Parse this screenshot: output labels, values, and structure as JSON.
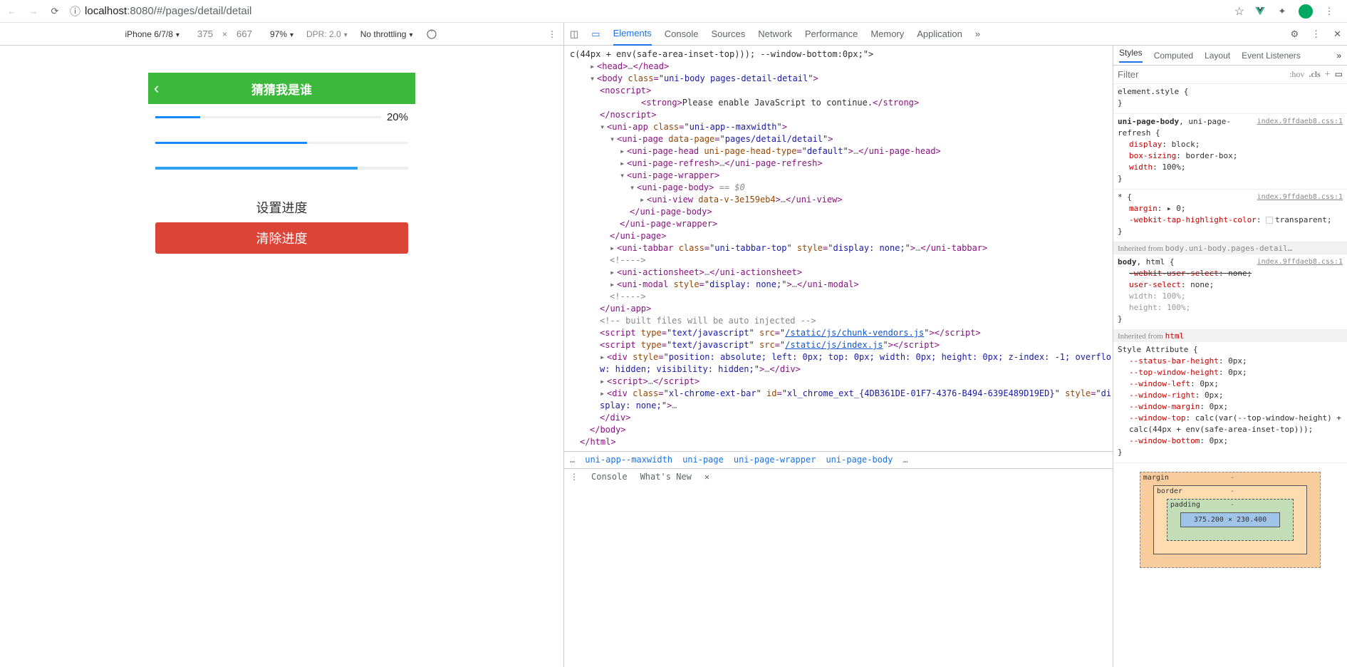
{
  "browser": {
    "url_host": "localhost",
    "url_port": ":8080",
    "url_path": "/#/pages/detail/detail"
  },
  "device_bar": {
    "device": "iPhone 6/7/8",
    "width": "375",
    "height": "667",
    "scale": "97%",
    "dpr": "DPR: 2.0",
    "throttling": "No throttling"
  },
  "app": {
    "title": "猜猜我是谁",
    "progress_pct": "20%",
    "p1_fill": "20%",
    "p2_fill": "60%",
    "p3_fill": "80%",
    "set_label": "设置进度",
    "clear_label": "清除进度"
  },
  "devtools_tabs": {
    "elements": "Elements",
    "console": "Console",
    "sources": "Sources",
    "network": "Network",
    "performance": "Performance",
    "memory": "Memory",
    "application": "Application"
  },
  "styles_tabs": {
    "styles": "Styles",
    "computed": "Computed",
    "layout": "Layout",
    "event": "Event Listeners"
  },
  "styles_filter": {
    "placeholder": "Filter",
    "hov": ":hov",
    "cls": ".cls"
  },
  "dom": {
    "line0": "c(44px + env(safe-area-inset-top))); --window-bottom:0px;\">",
    "head_open": "<head>",
    "head_close": "</head>",
    "body_open_1": "<body class=\"",
    "body_class": "uni-body pages-detail-detail",
    "body_open_2": "\">",
    "noscript_open": "<noscript>",
    "strong": "<strong>Please enable JavaScript to continue.</strong>",
    "noscript_close": "</noscript>",
    "uniapp_open": "<uni-app class=\"",
    "uniapp_class": "uni-app--maxwidth",
    "uniapp_close": "\">",
    "unipage_1": "<uni-page data-page=\"",
    "unipage_v": "pages/detail/detail",
    "unipage_2": "\">",
    "pagehead_1": "<uni-page-head uni-page-head-type=\"",
    "pagehead_v": "default",
    "pagehead_2": "\">…</uni-page-head>",
    "pagerefresh": "<uni-page-refresh>…</uni-page-refresh>",
    "pagewrapper_open": "<uni-page-wrapper>",
    "pagebody_open": "<uni-page-body>",
    "pagebody_sel": " == $0",
    "uniview": "<uni-view data-v-3e159eb4>…</uni-view>",
    "pagebody_close": "</uni-page-body>",
    "pagewrapper_close": "</uni-page-wrapper>",
    "unipage_close": "</uni-page>",
    "tabbar_1": "<uni-tabbar class=\"",
    "tabbar_class": "uni-tabbar-top",
    "tabbar_style": "display: none;",
    "tabbar_2": "\">…</uni-tabbar>",
    "comment1": "<!---->",
    "actionsheet": "<uni-actionsheet>…</uni-actionsheet>",
    "unimodal_style": "display: none;",
    "uniapp_close2": "</uni-app>",
    "built_comment": "<!-- built files will be auto injected -->",
    "script1_src": "/static/js/chunk-vendors.js",
    "script2_src": "/static/js/index.js",
    "div_abs_style": "position: absolute; left: 0px; top: 0px; width: 0px; height: 0px; z-index: -1; overflow: hidden; visibility: hidden;",
    "script3": "<script>…</scr",
    "script3_b": "ipt>",
    "xl_class": "xl-chrome-ext-bar",
    "xl_id": "xl_chrome_ext_{4DB361DE-01F7-4376-B494-639E489D19ED}",
    "xl_style": "display: none;",
    "div_close": "</div>",
    "body_close": "</body>",
    "html_close": "</html>"
  },
  "crumbs": {
    "c1": "uni-app--maxwidth",
    "c2": "uni-page",
    "c3": "uni-page-wrapper",
    "c4": "uni-page-body"
  },
  "drawer": {
    "console": "Console",
    "whatsnew": "What's New"
  },
  "styles": {
    "elstyle": "element.style {",
    "src1": "index.9ffdaeb8.css:1",
    "r1_sel": "uni-page-body, uni-page-refresh {",
    "r1_p1": "display",
    "r1_v1": ": block;",
    "r1_p2": "box-sizing",
    "r1_v2": ": border-box;",
    "r1_p3": "width",
    "r1_v3": ": 100%;",
    "r2_sel": "* {",
    "r2_p1": "margin",
    "r2_v1": ": ▸ 0;",
    "r2_p2": "-webkit-tap-highlight-color",
    "r2_v2": "transparent",
    "inh1": "Inherited from ",
    "inh1_ref": "body.uni-body.pages-detail…",
    "r3_sel": "body, html {",
    "r3_p1": "-webkit-user-select",
    "r3_v1": ": none;",
    "r3_p2": "user-select",
    "r3_v2": ": none;",
    "r3_p3": "width",
    "r3_v3": ": 100%;",
    "r3_p4": "height",
    "r3_v4": ": 100%;",
    "inh2": "Inherited from ",
    "inh2_ref": "html",
    "r4_sel": "Style Attribute {",
    "r4_p1": "--status-bar-height",
    "r4_v1": ": 0px;",
    "r4_p2": "--top-window-height",
    "r4_v2": ": 0px;",
    "r4_p3": "--window-left",
    "r4_v3": ": 0px;",
    "r4_p4": "--window-right",
    "r4_v4": ": 0px;",
    "r4_p5": "--window-margin",
    "r4_v5": ": 0px;",
    "r4_p6": "--window-top",
    "r4_v6": ": calc(var(--top-window-height) + calc(44px + env(safe-area-inset-top)));",
    "r4_p7": "--window-bottom",
    "r4_v7": ": 0px;"
  },
  "boxmodel": {
    "margin": "margin",
    "border": "border",
    "padding": "padding",
    "content": "375.200 × 230.400"
  }
}
